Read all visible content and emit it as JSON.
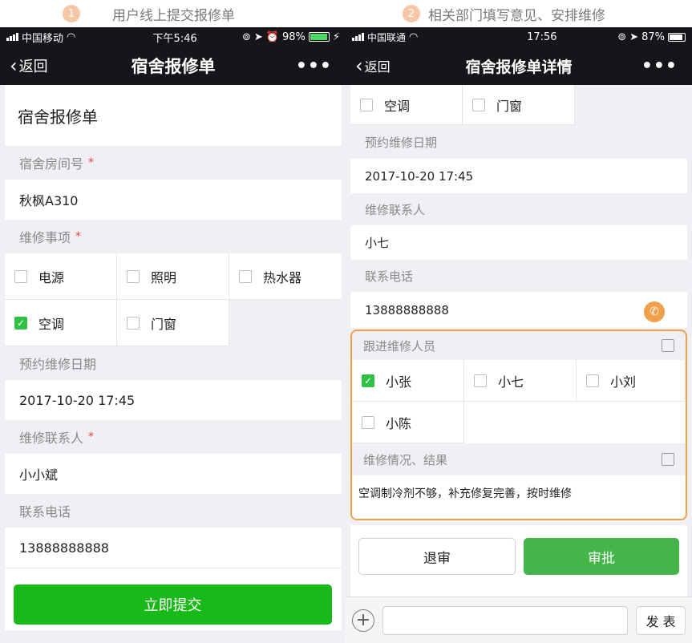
{
  "steps": [
    {
      "num": "1",
      "text": "用户线上提交报修单"
    },
    {
      "num": "2",
      "text": "相关部门填写意见、安排维修"
    }
  ],
  "phone1": {
    "status": {
      "carrier": "中国移动",
      "time": "下午5:46",
      "battery": "98%"
    },
    "nav": {
      "back": "返回",
      "title": "宿舍报修单",
      "more": "•••"
    },
    "form_title": "宿舍报修单",
    "room": {
      "label": "宿舍房间号",
      "required": "*",
      "value": "秋枫A310"
    },
    "items": {
      "label": "维修事项",
      "required": "*",
      "options": [
        {
          "label": "电源",
          "checked": false
        },
        {
          "label": "照明",
          "checked": false
        },
        {
          "label": "热水器",
          "checked": false
        },
        {
          "label": "空调",
          "checked": true
        },
        {
          "label": "门窗",
          "checked": false
        }
      ]
    },
    "date": {
      "label": "预约维修日期",
      "value": "2017-10-20 17:45"
    },
    "contact": {
      "label": "维修联系人",
      "required": "*",
      "value": "小小斌"
    },
    "phone": {
      "label": "联系电话",
      "value": "13888888888"
    },
    "submit": "立即提交"
  },
  "phone2": {
    "status": {
      "carrier": "中国联通",
      "time": "17:56",
      "battery": "87%"
    },
    "nav": {
      "back": "返回",
      "title": "宿舍报修单详情",
      "more": "•••"
    },
    "items": [
      {
        "label": "空调",
        "checked": false
      },
      {
        "label": "门窗",
        "checked": false
      }
    ],
    "date": {
      "label": "预约维修日期",
      "value": "2017-10-20 17:45"
    },
    "contact": {
      "label": "维修联系人",
      "value": "小七"
    },
    "phone": {
      "label": "联系电话",
      "value": "13888888888"
    },
    "staff": {
      "label": "跟进维修人员",
      "options": [
        {
          "label": "小张",
          "checked": true
        },
        {
          "label": "小七",
          "checked": false
        },
        {
          "label": "小刘",
          "checked": false
        },
        {
          "label": "小陈",
          "checked": false
        }
      ]
    },
    "result": {
      "label": "维修情况、结果",
      "value": "空调制冷剂不够，补充修复完善，按时维修"
    },
    "reject": "退审",
    "approve": "审批",
    "send": "发 表"
  },
  "colors": {
    "green": "#2ec143",
    "accent": "#f0a04b",
    "dark": "#15151a"
  }
}
